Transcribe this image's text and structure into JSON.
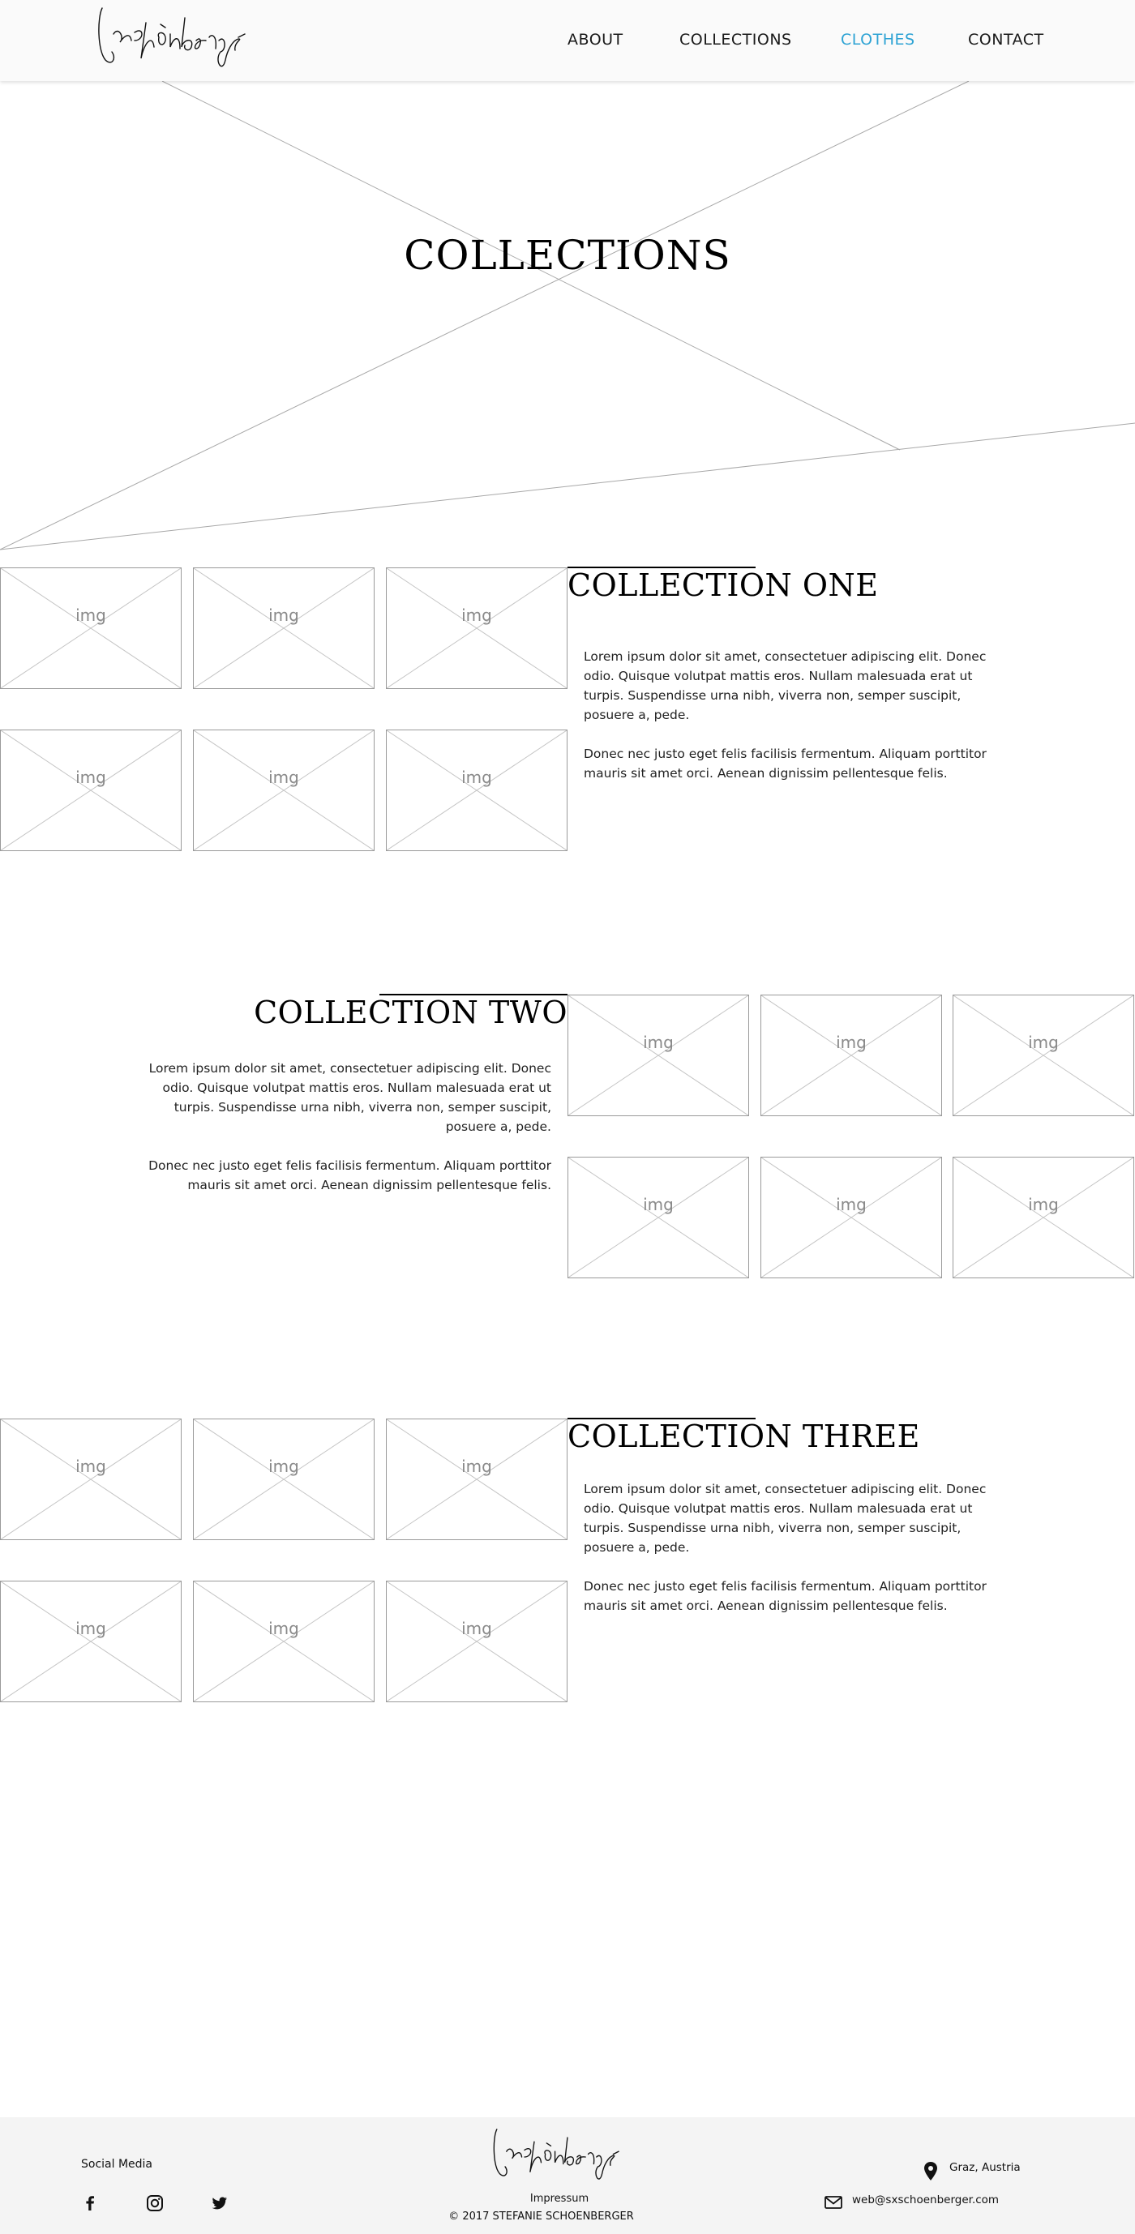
{
  "header": {
    "logo_alt": "Schönberger",
    "nav": [
      {
        "label": "ABOUT"
      },
      {
        "label": "COLLECTIONS"
      },
      {
        "label": "CLOTHES",
        "active": true
      },
      {
        "label": "CONTACT"
      }
    ],
    "active_color": "#2ea3d4"
  },
  "hero": {
    "title": "COLLECTIONS"
  },
  "placeholder_label": "img",
  "collections": [
    {
      "title": "COLLECTION ONE",
      "paragraphs": [
        "Lorem ipsum dolor sit amet, consectetuer adipiscing elit. Donec odio. Quisque volutpat mattis eros. Nullam malesuada erat ut turpis. Suspendisse urna nibh, viverra non, semper suscipit, posuere a, pede.",
        "Donec nec justo eget felis facilisis fermentum. Aliquam porttitor mauris sit amet orci. Aenean dignissim pellentesque felis."
      ]
    },
    {
      "title": "COLLECTION TWO",
      "paragraphs": [
        "Lorem ipsum dolor sit amet, consectetuer adipiscing elit. Donec odio. Quisque volutpat mattis eros. Nullam malesuada erat ut turpis. Suspendisse urna nibh, viverra non, semper suscipit, posuere a, pede.",
        "Donec nec justo eget felis facilisis fermentum. Aliquam porttitor mauris sit amet orci. Aenean dignissim pellentesque felis."
      ]
    },
    {
      "title": "COLLECTION THREE",
      "paragraphs": [
        "Lorem ipsum dolor sit amet, consectetuer adipiscing elit. Donec odio. Quisque volutpat mattis eros. Nullam malesuada erat ut turpis. Suspendisse urna nibh, viverra non, semper suscipit, posuere a, pede.",
        "Donec nec justo eget felis facilisis fermentum. Aliquam porttitor mauris sit amet orci. Aenean dignissim pellentesque felis."
      ]
    }
  ],
  "footer": {
    "social_label": "Social Media",
    "social_icons": [
      "facebook-icon",
      "instagram-icon",
      "twitter-icon"
    ],
    "impressum": "Impressum",
    "copyright": "© 2017 STEFANIE SCHOENBERGER",
    "location": "Graz, Austria",
    "email": "web@sxschoenberger.com"
  }
}
